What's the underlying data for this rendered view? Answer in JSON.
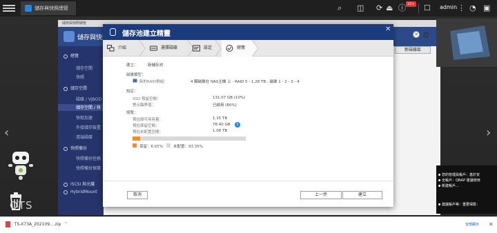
{
  "topbar": {
    "tab_label": "儲存與快照總管",
    "notification_count": "10+",
    "username": "admin"
  },
  "desktop": {
    "os_label": "QTS"
  },
  "bg_window": {
    "title_small": "儲存與快照總管",
    "header_title": "儲存與快照",
    "new_volume_button": "新磁碟區",
    "sidebar": {
      "overview": "總覽",
      "overview_items": [
        "儲存空間",
        "快照"
      ],
      "storage": "儲存空間",
      "storage_items": [
        "磁碟 / VJBOD",
        "儲存空間 / 快",
        "快取加速",
        "外接儲存裝置",
        "遠端磁碟"
      ],
      "snapshot_backup": "快照備份",
      "snapshot_items": [
        "快照備份任務",
        "快照備份保護"
      ],
      "iscsi": "iSCSI 與光纖",
      "hybridmount": "HybridMount"
    }
  },
  "dialog": {
    "title": "儲存池建立精靈",
    "steps": [
      "介紹",
      "選擇磁碟",
      "設定",
      "總覽"
    ],
    "section_create": "建立：",
    "create_value": "新儲存池",
    "section_disks": "磁碟類型：",
    "new_raid_label": "新的RAID群組：",
    "new_raid_value": "4 顆磁碟在 NAS主機 上 - RAID 5 - 1.28 TB : 磁碟 1 - 2 - 3 - 4",
    "section_settings": "設定：",
    "ssd_reserve_label": "SSD 預留空間：",
    "ssd_reserve_value": "131.07 GB (10%)",
    "alert_threshold_label": "警示臨界值：",
    "alert_threshold_value": "已啟用 (80%)",
    "section_overview": "總覽：",
    "usable_capacity_label": "預估總可用容量：",
    "usable_capacity_value": "1.15 TB",
    "reserved_space_label": "預估保留空間：",
    "reserved_space_value": "78.40 GB",
    "unallocated_label": "預估未配置空間：",
    "unallocated_value": "1.08 TB",
    "reserved_percent": 6.65,
    "legend_reserved": "保留：6.65%",
    "legend_unallocated": "未配置：93.35%",
    "cancel_button": "取消",
    "back_button": "上一步",
    "create_button": "建立"
  },
  "right_panel": {
    "lines": [
      "您的管理員帳戶：基於安",
      "全帳戶：QNAP 建議使用",
      "新建帳戶...",
      "",
      "建議帳戶等：重要保險："
    ]
  },
  "download_bar": {
    "file_name": "TS-X73A_202109....zip",
    "show_all": "全部顯示"
  },
  "colors": {
    "dialog_header": "#1b3c7c",
    "reserved_orange": "#ff8c1a",
    "unallocated_gray": "#d8d8d8",
    "sidebar_bg": "#25356b"
  }
}
